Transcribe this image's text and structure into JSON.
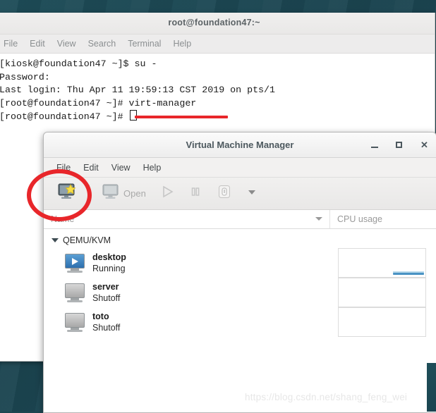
{
  "desktop": {
    "bg_color": "#1d4650"
  },
  "terminal": {
    "title": "root@foundation47:~",
    "menus": [
      "File",
      "Edit",
      "View",
      "Search",
      "Terminal",
      "Help"
    ],
    "lines": [
      "[kiosk@foundation47 ~]$ su -",
      "Password:",
      "Last login: Thu Apr 11 19:59:13 CST 2019 on pts/1",
      "[root@foundation47 ~]# virt-manager",
      "[root@foundation47 ~]# "
    ],
    "highlighted_command": "virt-manager"
  },
  "vmm": {
    "title": "Virtual Machine Manager",
    "window_buttons": [
      "minimize",
      "maximize",
      "close"
    ],
    "menus": [
      "File",
      "Edit",
      "View",
      "Help"
    ],
    "toolbar": {
      "new_vm_label": "",
      "open_label": "Open",
      "run_label": "",
      "pause_label": "",
      "shutdown_label": "",
      "dropdown_label": ""
    },
    "columns": [
      "Name",
      "CPU usage"
    ],
    "connection": "QEMU/KVM",
    "vms": [
      {
        "name": "desktop",
        "state": "Running",
        "running": true
      },
      {
        "name": "server",
        "state": "Shutoff",
        "running": false
      },
      {
        "name": "toto",
        "state": "Shutoff",
        "running": false
      }
    ]
  },
  "annotations": {
    "accent_color": "#e8262a",
    "watermark": "https://blog.csdn.net/shang_feng_wei"
  }
}
